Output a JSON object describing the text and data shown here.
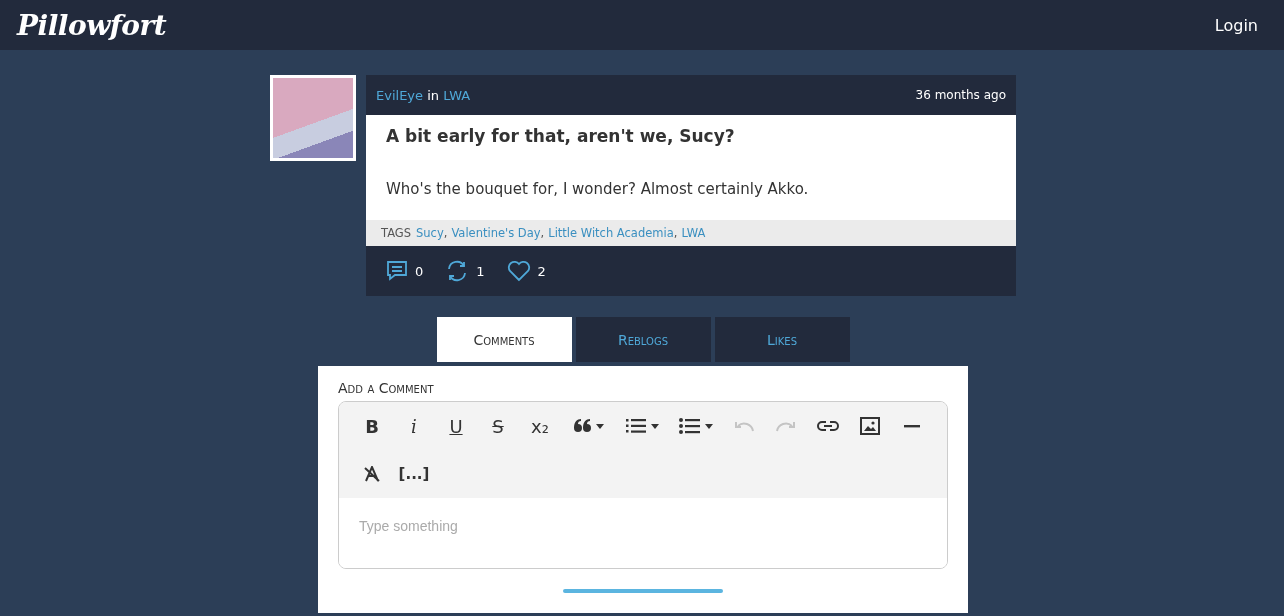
{
  "header": {
    "logo": "Pillowfort",
    "login": "Login"
  },
  "post": {
    "author": "EvilEye",
    "in": "in",
    "community": "LWA",
    "time": "36 months ago",
    "title": "A bit early for that, aren't we, Sucy?",
    "body": "Who's the bouquet for, I wonder? Almost certainly Akko.",
    "tags_label": "TAGS",
    "tag_separator": ",",
    "tags": [
      "Sucy",
      "Valentine's Day",
      "Little Witch Academia",
      "LWA"
    ],
    "actions": [
      {
        "kind": "comment",
        "count": "0"
      },
      {
        "kind": "reblog",
        "count": "1"
      },
      {
        "kind": "like",
        "count": "2"
      }
    ]
  },
  "tabs": [
    {
      "label": "Comments",
      "selected": true
    },
    {
      "label": "Reblogs",
      "selected": false
    },
    {
      "label": "Likes",
      "selected": false
    }
  ],
  "comment_form": {
    "heading": "Add a Comment",
    "placeholder": "Type something",
    "toolbar": [
      {
        "kind": "bold",
        "glyph": "B",
        "dropdown": false,
        "disabled": false
      },
      {
        "kind": "italic",
        "glyph": "i",
        "dropdown": false,
        "disabled": false
      },
      {
        "kind": "underline",
        "glyph": "U",
        "dropdown": false,
        "disabled": false
      },
      {
        "kind": "strike",
        "glyph": "S",
        "dropdown": false,
        "disabled": false
      },
      {
        "kind": "subscript",
        "glyph": "x₂",
        "dropdown": false,
        "disabled": false
      },
      {
        "kind": "quote",
        "dropdown": true,
        "disabled": false
      },
      {
        "kind": "ordered-list",
        "dropdown": true,
        "disabled": false
      },
      {
        "kind": "bullet-list",
        "dropdown": true,
        "disabled": false
      },
      {
        "kind": "undo",
        "dropdown": false,
        "disabled": true
      },
      {
        "kind": "redo",
        "dropdown": false,
        "disabled": true
      },
      {
        "kind": "link",
        "dropdown": false,
        "disabled": false
      },
      {
        "kind": "image",
        "dropdown": false,
        "disabled": false
      },
      {
        "kind": "rule",
        "dropdown": false,
        "disabled": false
      },
      {
        "kind": "clear-format",
        "dropdown": false,
        "disabled": false
      },
      {
        "kind": "more",
        "glyph": "[...]",
        "dropdown": false,
        "disabled": false
      }
    ]
  }
}
